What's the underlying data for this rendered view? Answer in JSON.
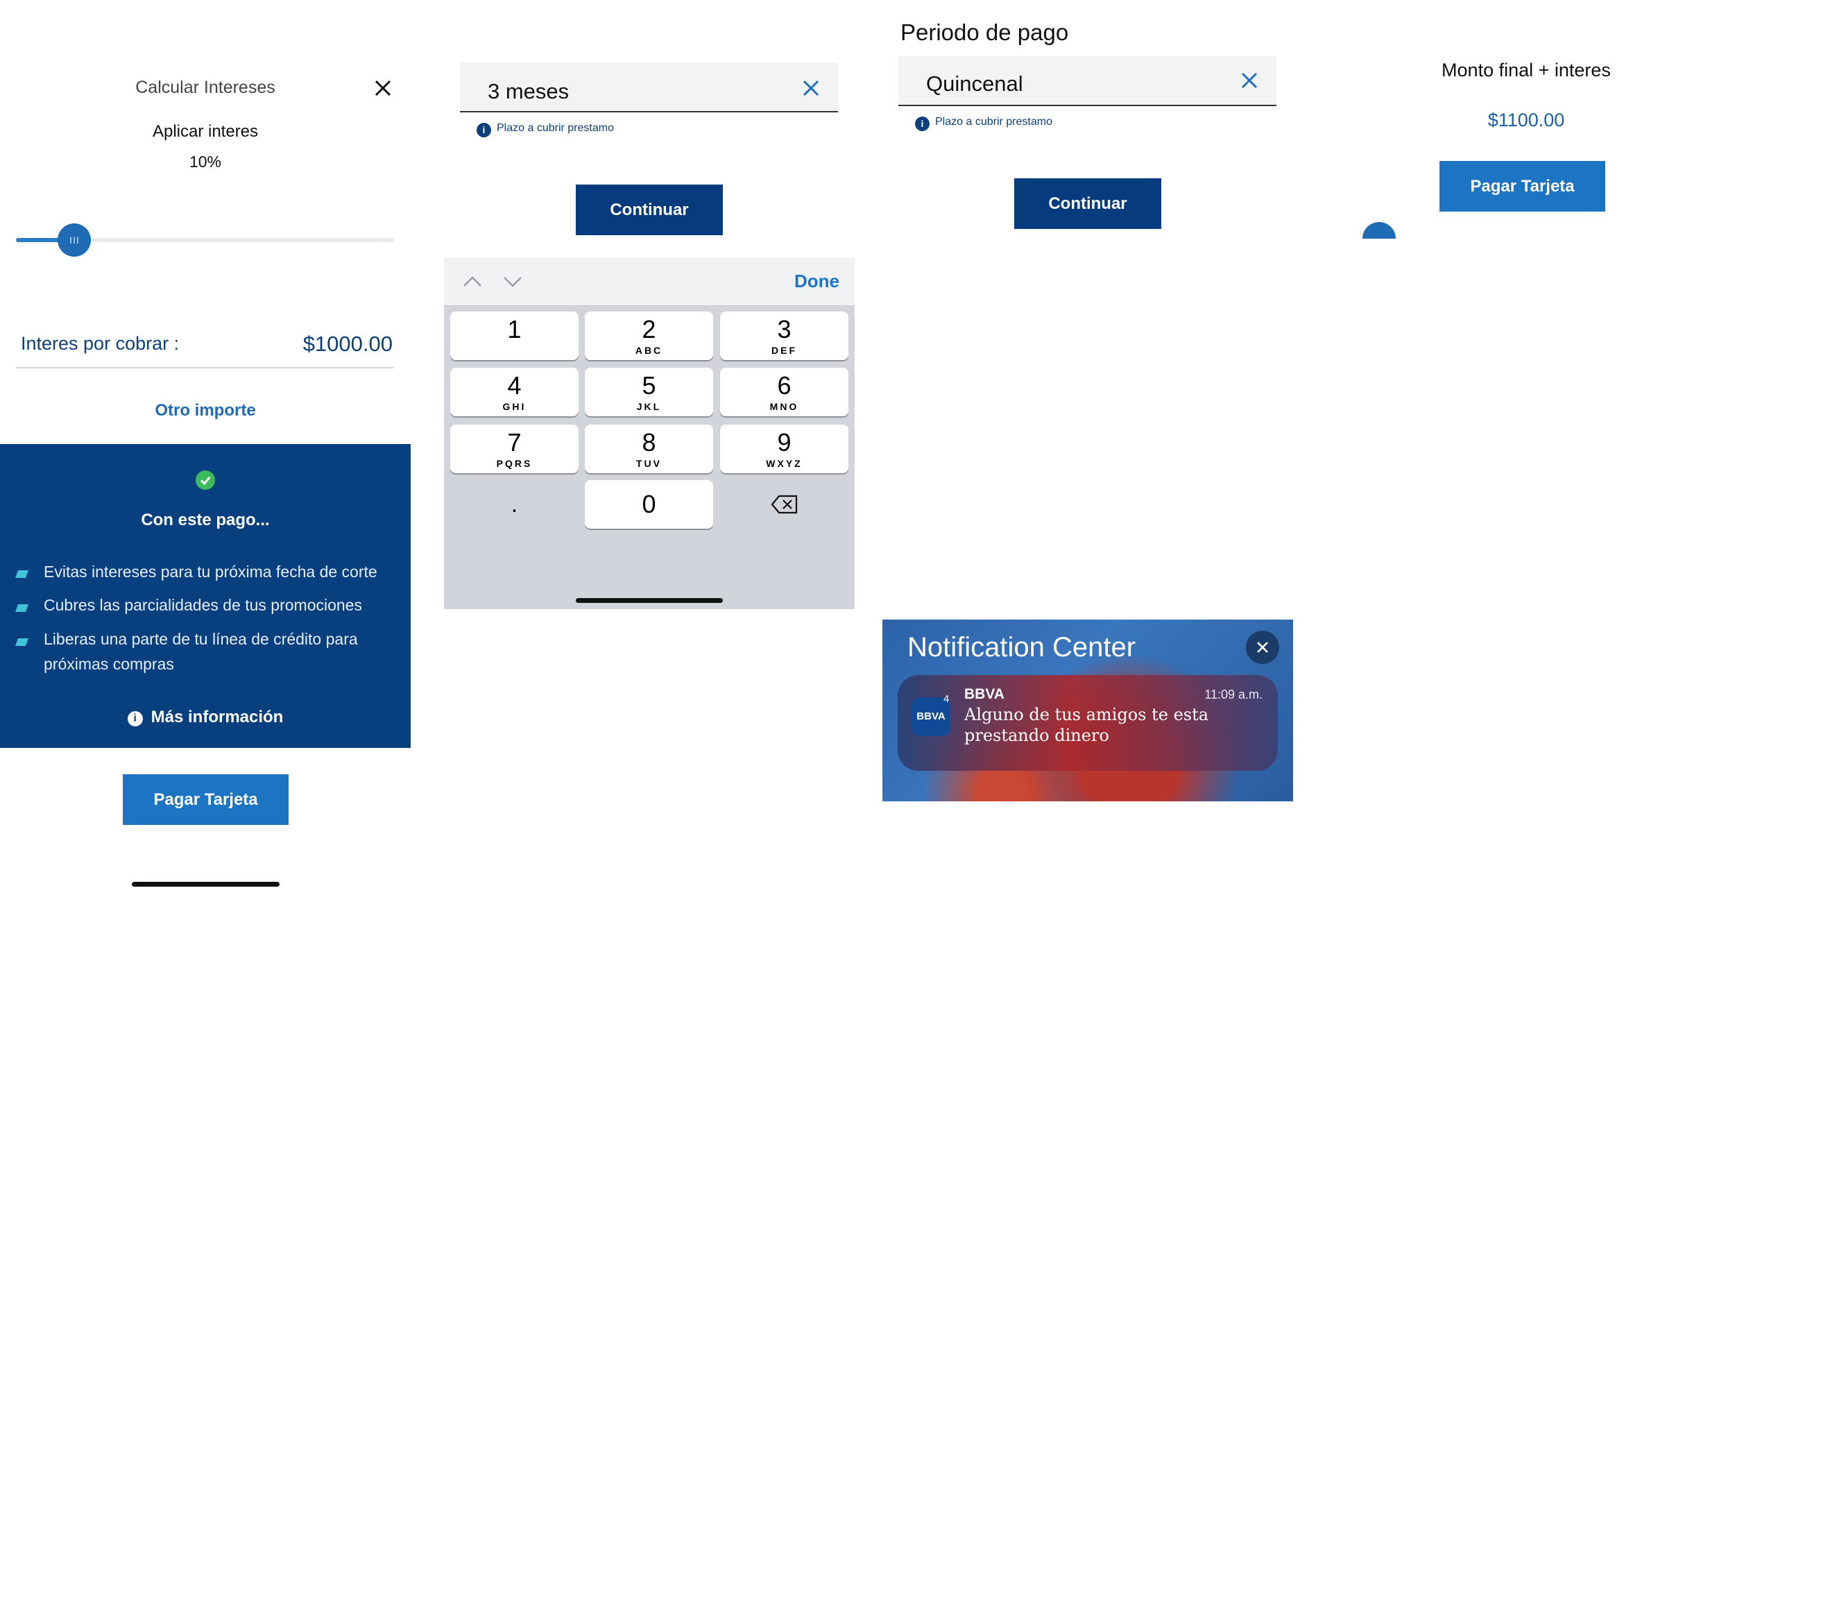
{
  "panel_calc": {
    "title": "Calcular Intereses",
    "apply_label": "Aplicar interes",
    "percent_text": "10%",
    "slider_level": 0.155,
    "slider_thumb_glyph": "III",
    "interest_label": "Interes por cobrar :",
    "interest_value": "$1000.00",
    "other_amount_link": "Otro importe",
    "card": {
      "title": "Con este pago...",
      "benefits": [
        "Evitas intereses para tu próxima fecha de corte",
        "Cubres las parcialidades de tus promociones",
        "Liberas una parte de tu línea de crédito para",
        "próximas compras"
      ],
      "more_info": "Más información"
    },
    "pay_button": "Pagar Tarjeta"
  },
  "panel_term": {
    "field_value": "3 meses",
    "hint": "Plazo a cubrir prestamo",
    "continue_button": "Continuar",
    "keyboard": {
      "done": "Done",
      "keys": [
        {
          "num": "1",
          "letters": ""
        },
        {
          "num": "2",
          "letters": "ABC"
        },
        {
          "num": "3",
          "letters": "DEF"
        },
        {
          "num": "4",
          "letters": "GHI"
        },
        {
          "num": "5",
          "letters": "JKL"
        },
        {
          "num": "6",
          "letters": "MNO"
        },
        {
          "num": "7",
          "letters": "PQRS"
        },
        {
          "num": "8",
          "letters": "TUV"
        },
        {
          "num": "9",
          "letters": "WXYZ"
        }
      ],
      "dot": ".",
      "zero": "0"
    }
  },
  "panel_period": {
    "title": "Periodo de pago",
    "field_value": "Quincenal",
    "hint": "Plazo a cubrir prestamo",
    "continue_button": "Continuar",
    "notification": {
      "header": "Notification Center",
      "app_icon_text": "BBVA",
      "badge": "4",
      "app_name": "BBVA",
      "time": "11:09 a.m.",
      "message": "Alguno de tus amigos te esta prestando dinero"
    }
  },
  "panel_final": {
    "title": "Monto final + interes",
    "amount": "$1100.00",
    "pay_button": "Pagar Tarjeta"
  },
  "colors": {
    "brand_dark": "#063b7d",
    "brand_blue": "#1d74c3",
    "success": "#3dbb5d",
    "accent_bullet": "#41c4d8",
    "ios_link": "#1a73d3"
  },
  "icons": [
    "close-icon",
    "check-circle-icon",
    "info-icon",
    "chevron-up-icon",
    "chevron-down-icon",
    "backspace-icon"
  ]
}
